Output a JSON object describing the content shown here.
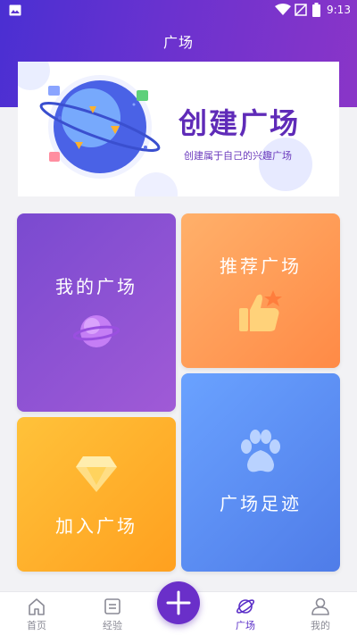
{
  "status_bar": {
    "time": "9:13"
  },
  "page": {
    "title": "广场"
  },
  "banner": {
    "title": "创建广场",
    "subtitle": "创建属于自己的兴趣广场"
  },
  "cards": {
    "my_plaza": {
      "label": "我的广场",
      "icon": "planet-icon"
    },
    "recommended_plaza": {
      "label": "推荐广场",
      "icon": "thumbs-up-icon"
    },
    "join_plaza": {
      "label": "加入广场",
      "icon": "diamond-icon"
    },
    "plaza_footprints": {
      "label": "广场足迹",
      "icon": "paw-icon"
    }
  },
  "tabbar": {
    "items": [
      {
        "label": "首页",
        "icon": "home-icon"
      },
      {
        "label": "经验",
        "icon": "note-icon"
      },
      {
        "label": "广场",
        "icon": "planet-icon"
      },
      {
        "label": "我的",
        "icon": "user-icon"
      }
    ],
    "active_index": 2
  },
  "colors": {
    "header_start": "#4a2fd2",
    "header_end": "#8a35c8",
    "accent": "#6a2fc9",
    "card_my_plaza": "#8a50d3",
    "card_recommended": "#ff9a55",
    "card_join": "#ffb22c",
    "card_footprints": "#5b8bf0"
  }
}
